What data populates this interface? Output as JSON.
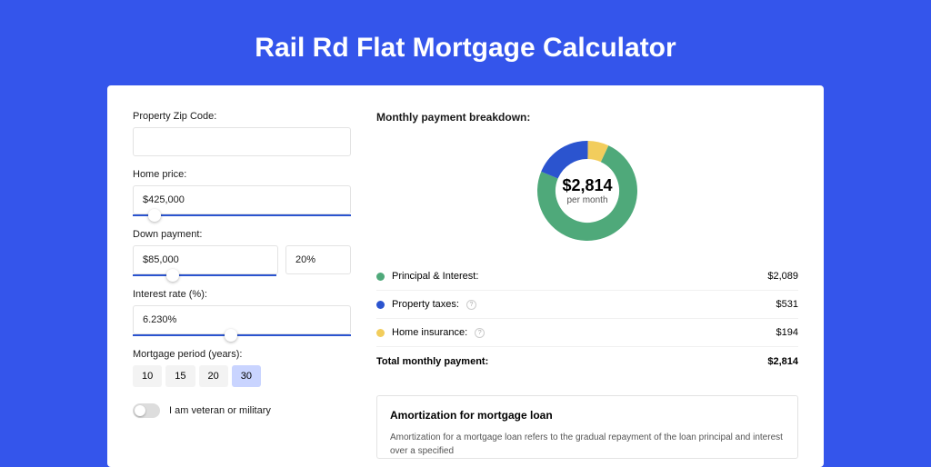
{
  "title": "Rail Rd Flat Mortgage Calculator",
  "form": {
    "zip_label": "Property Zip Code:",
    "zip_value": "",
    "home_price_label": "Home price:",
    "home_price_value": "$425,000",
    "home_price_slider_pct": 10,
    "down_label": "Down payment:",
    "down_value": "$85,000",
    "down_pct_value": "20%",
    "down_slider_pct": 28,
    "rate_label": "Interest rate (%):",
    "rate_value": "6.230%",
    "rate_slider_pct": 45,
    "period_label": "Mortgage period (years):",
    "period_options": [
      "10",
      "15",
      "20",
      "30"
    ],
    "period_active_index": 3,
    "veteran_label": "I am veteran or military",
    "veteran_on": false
  },
  "breakdown": {
    "heading": "Monthly payment breakdown:",
    "center_amount": "$2,814",
    "center_sub": "per month",
    "items": [
      {
        "color": "green",
        "label": "Principal & Interest:",
        "info": false,
        "value": "$2,089"
      },
      {
        "color": "blue",
        "label": "Property taxes:",
        "info": true,
        "value": "$531"
      },
      {
        "color": "yellow",
        "label": "Home insurance:",
        "info": true,
        "value": "$194"
      }
    ],
    "total_label": "Total monthly payment:",
    "total_value": "$2,814"
  },
  "chart_data": {
    "type": "pie",
    "title": "Monthly payment breakdown:",
    "series": [
      {
        "name": "Principal & Interest",
        "value": 2089,
        "color": "#4fa97a"
      },
      {
        "name": "Property taxes",
        "value": 531,
        "color": "#2b54cf"
      },
      {
        "name": "Home insurance",
        "value": 194,
        "color": "#f2cd5c"
      }
    ],
    "total": 2814,
    "center_label": "$2,814 per month"
  },
  "amort": {
    "title": "Amortization for mortgage loan",
    "text": "Amortization for a mortgage loan refers to the gradual repayment of the loan principal and interest over a specified"
  }
}
